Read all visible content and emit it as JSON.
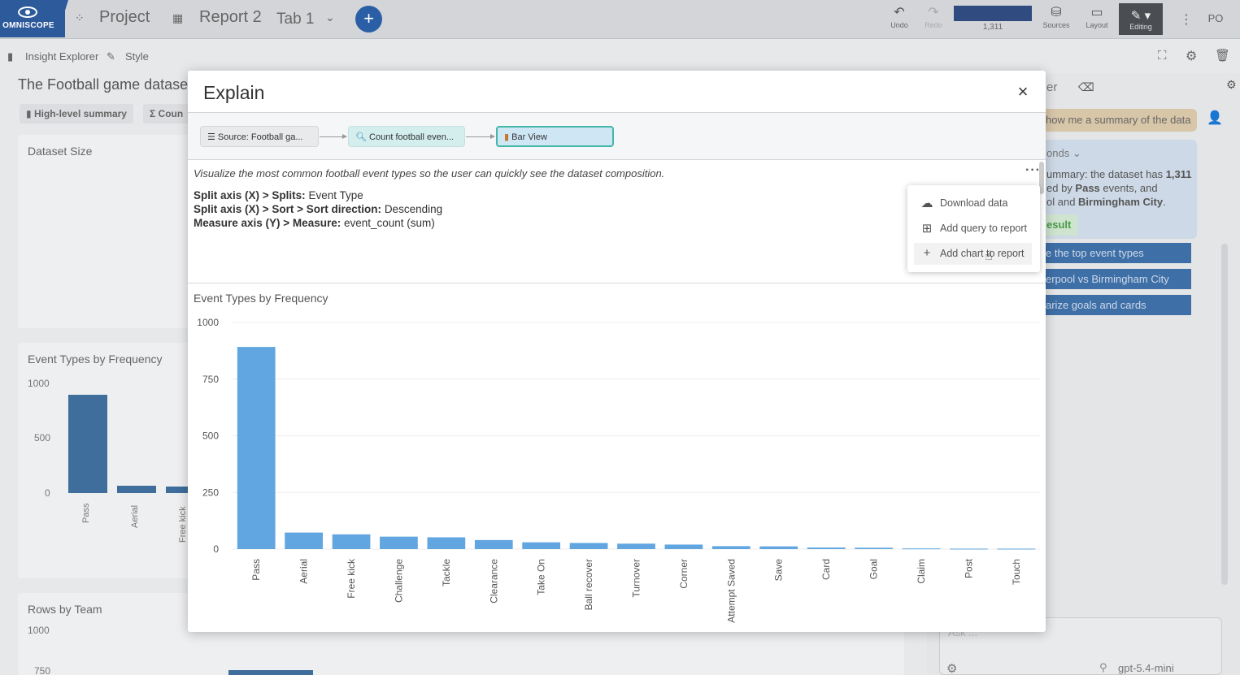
{
  "topbar": {
    "brand": "OMNISCOPE",
    "project": "Project",
    "report": "Report 2",
    "tab": "Tab 1",
    "undo": "Undo",
    "redo": "Redo",
    "row_count": "1,311",
    "sources": "Sources",
    "layout": "Layout",
    "editing": "Editing",
    "user_initials": "PO"
  },
  "subbar": {
    "insight_explorer": "Insight Explorer",
    "style": "Style"
  },
  "background": {
    "title": "The Football game datase",
    "chips": [
      "High-level summary",
      "Σ Coun"
    ],
    "dataset_size": "Dataset Size",
    "event_types_title": "Event Types by Frequency",
    "event_ticks": [
      "1000",
      "500",
      "0"
    ],
    "event_labels": [
      "Pass",
      "Aerial",
      "Free kick"
    ],
    "rows_by_team": "Rows by Team",
    "rows_ticks": [
      "1000",
      "750"
    ]
  },
  "assistant": {
    "tab_partial": "er",
    "user_message": "how me a summary of the data",
    "seconds": "onds",
    "line1": "ummary: the dataset has ",
    "line1_bold": "1,311",
    "line2": "ed by ",
    "line2_bold": "Pass",
    "line2_end": " events, and",
    "line3": "ol and ",
    "line3_bold": "Birmingham City",
    "line3_end": ".",
    "result": "esult",
    "suggestions": [
      "e the top event types",
      "erpool vs Birmingham City",
      "arize goals and cards"
    ],
    "input_placeholder": "Ask ...",
    "model": "gpt-5.4-mini"
  },
  "modal": {
    "title": "Explain",
    "close_symbol": "×",
    "flow": {
      "source": "Source: Football ga...",
      "query": "Count football even...",
      "view": "Bar View"
    },
    "description": "Visualize the most common football event types so the user can quickly see the dataset composition.",
    "specs": [
      {
        "key": "Split axis (X) > Splits:",
        "value": "Event Type"
      },
      {
        "key": "Split axis (X) > Sort > Sort direction:",
        "value": "Descending"
      },
      {
        "key": "Measure axis (Y) > Measure:",
        "value": "event_count (sum)"
      }
    ],
    "menu": {
      "download": "Download data",
      "add_query": "Add query to report",
      "add_chart": "Add chart to report"
    }
  },
  "chart_data": {
    "type": "bar",
    "title": "Event Types by Frequency",
    "xlabel": "",
    "ylabel": "",
    "ylim": [
      0,
      1000
    ],
    "yticks": [
      0,
      250,
      500,
      750,
      1000
    ],
    "grid": true,
    "categories": [
      "Pass",
      "Aerial",
      "Free kick",
      "Challenge",
      "Tackle",
      "Clearance",
      "Take On",
      "Ball recover",
      "Turnover",
      "Corner",
      "Attempt Saved",
      "Save",
      "Card",
      "Goal",
      "Claim",
      "Post",
      "Touch"
    ],
    "values": [
      892,
      73,
      65,
      55,
      52,
      40,
      30,
      27,
      24,
      20,
      13,
      12,
      7,
      6,
      3,
      2,
      2
    ],
    "bar_color": "#61a6e0"
  }
}
